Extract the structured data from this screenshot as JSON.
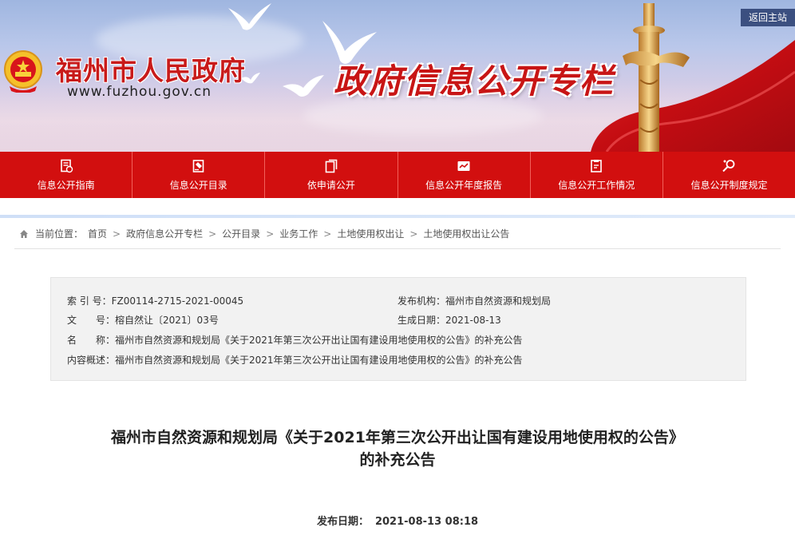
{
  "banner": {
    "site_name": "福州市人民政府",
    "site_url": "www.fuzhou.gov.cn",
    "title": "政府信息公开专栏",
    "back_home": "返回主站"
  },
  "nav": {
    "items": [
      {
        "label": "信息公开指南",
        "icon": "guide-icon"
      },
      {
        "label": "信息公开目录",
        "icon": "catalog-icon"
      },
      {
        "label": "依申请公开",
        "icon": "application-icon"
      },
      {
        "label": "信息公开年度报告",
        "icon": "report-icon"
      },
      {
        "label": "信息公开工作情况",
        "icon": "work-status-icon"
      },
      {
        "label": "信息公开制度规定",
        "icon": "regulation-icon"
      }
    ]
  },
  "breadcrumb": {
    "prefix": "当前位置：",
    "items": [
      "首页",
      "政府信息公开专栏",
      "公开目录",
      "业务工作",
      "土地使用权出让",
      "土地使用权出让公告"
    ]
  },
  "meta": {
    "index_key": "索 引 号：",
    "index_val": "FZ00114-2715-2021-00045",
    "publisher_key": "发布机构：",
    "publisher_val": "福州市自然资源和规划局",
    "doc_key": "文　　号：",
    "doc_val": "榕自然让〔2021〕03号",
    "date_key": "生成日期：",
    "date_val": "2021-08-13",
    "name_key": "名　　称：",
    "name_val": "福州市自然资源和规划局《关于2021年第三次公开出让国有建设用地使用权的公告》的补充公告",
    "summary_key": "内容概述：",
    "summary_val": "福州市自然资源和规划局《关于2021年第三次公开出让国有建设用地使用权的公告》的补充公告"
  },
  "article": {
    "title_line1": "福州市自然资源和规划局《关于2021年第三次公开出让国有建设用地使用权的公告》",
    "title_line2": "的补充公告",
    "pub_label": "发布日期：",
    "pub_value": "2021-08-13 08:18"
  },
  "colors": {
    "nav_red": "#d20f0f",
    "title_red": "#c81515"
  }
}
